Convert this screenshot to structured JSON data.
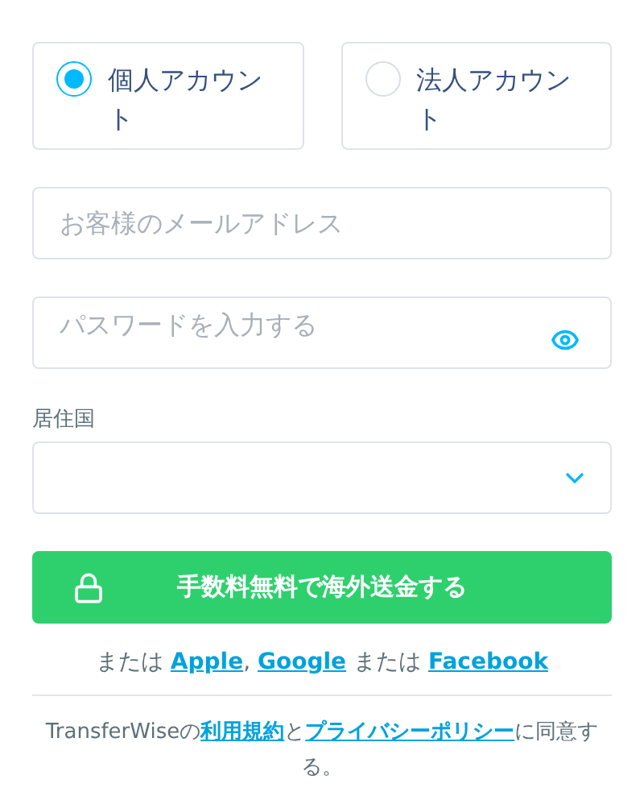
{
  "account_types": [
    {
      "label": "個人アカウント",
      "selected": true
    },
    {
      "label": "法人アカウント",
      "selected": false
    }
  ],
  "email_field": {
    "placeholder": "お客様のメールアドレス"
  },
  "password_field": {
    "placeholder": "パスワードを入力する"
  },
  "country_field": {
    "label": "居住国"
  },
  "submit_button": {
    "label": "手数料無料で海外送金する"
  },
  "social_login": [
    {
      "kind": "text",
      "text": "または "
    },
    {
      "kind": "link",
      "text": "Apple"
    },
    {
      "kind": "text",
      "text": ", "
    },
    {
      "kind": "link",
      "text": "Google"
    },
    {
      "kind": "text",
      "text": " または "
    },
    {
      "kind": "link",
      "text": "Facebook"
    }
  ],
  "terms": [
    {
      "kind": "text",
      "text": "TransferWiseの"
    },
    {
      "kind": "link",
      "text": "利用規約"
    },
    {
      "kind": "text",
      "text": "と"
    },
    {
      "kind": "link",
      "text": "プライバシーポリシー"
    },
    {
      "kind": "text",
      "text": "に同意する。"
    }
  ]
}
